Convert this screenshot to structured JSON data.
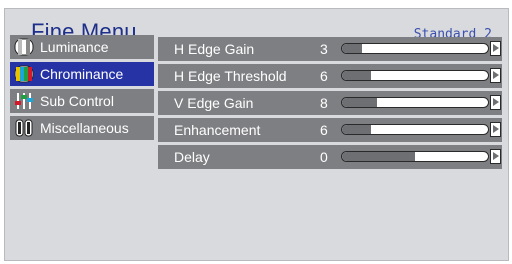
{
  "header": {
    "title": "Fine Menu",
    "preset": "Standard 2"
  },
  "sidebar": {
    "items": [
      {
        "label": "Luminance",
        "icon": "luminance-icon"
      },
      {
        "label": "Chrominance",
        "icon": "chrominance-icon",
        "selected": true
      },
      {
        "label": "Sub Control",
        "icon": "sliders-icon"
      },
      {
        "label": "Miscellaneous",
        "icon": "miscellaneous-icon"
      }
    ]
  },
  "params": {
    "items": [
      {
        "label": "H Edge Gain",
        "value": "3",
        "level": 0.14
      },
      {
        "label": "H Edge Threshold",
        "value": "6",
        "level": 0.2
      },
      {
        "label": "V Edge Gain",
        "value": "8",
        "level": 0.24
      },
      {
        "label": "Enhancement",
        "value": "6",
        "level": 0.2
      },
      {
        "label": "Delay",
        "value": "0",
        "level": 0.5
      }
    ]
  },
  "colors": {
    "title": "#1d2f8a",
    "selected": "#2533a4",
    "row": "#7e7f82",
    "panel": "#d9dadd"
  }
}
